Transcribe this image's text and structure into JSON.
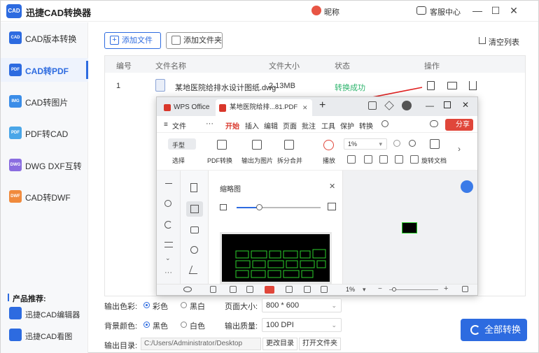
{
  "app": {
    "logo_text": "CAD",
    "title": "迅捷CAD转换器",
    "nickname": "昵称",
    "service": "客服中心",
    "brand_color": "#2d6be0"
  },
  "sidebar": {
    "items": [
      {
        "label": "CAD版本转换",
        "icon_text": "CAD",
        "color": "#2d6be0"
      },
      {
        "label": "CAD转PDF",
        "icon_text": "PDF",
        "color": "#2d6be0",
        "active": true
      },
      {
        "label": "CAD转图片",
        "icon_text": "IMG",
        "color": "#3b8de8"
      },
      {
        "label": "PDF转CAD",
        "icon_text": "PDF",
        "color": "#4aa6e8"
      },
      {
        "label": "DWG DXF互转",
        "icon_text": "DWG",
        "color": "#8a6de0"
      },
      {
        "label": "CAD转DWF",
        "icon_text": "DWF",
        "color": "#f08a3c"
      }
    ],
    "recommend_title": "产品推荐:",
    "recommend": [
      {
        "label": "迅捷CAD编辑器"
      },
      {
        "label": "迅捷CAD看图"
      }
    ]
  },
  "toolbar": {
    "add_file": "添加文件",
    "add_folder": "添加文件夹",
    "clear_list": "清空列表"
  },
  "table": {
    "headers": [
      "编号",
      "文件名称",
      "文件大小",
      "状态",
      "操作"
    ],
    "rows": [
      {
        "index": "1",
        "name": "某地医院给排水设计图纸.dwg",
        "size": "2.13MB",
        "status": "转换成功"
      }
    ]
  },
  "settings": {
    "color_label": "输出色彩:",
    "color_opt1": "彩色",
    "color_opt2": "黑白",
    "page_label": "页面大小:",
    "page_value": "800 * 600",
    "bg_label": "背景颜色:",
    "bg_opt1": "黑色",
    "bg_opt2": "白色",
    "quality_label": "输出质量:",
    "quality_value": "100 DPI",
    "dir_label": "输出目录:",
    "dir_value": "C:/Users/Administrator/Desktop",
    "change_dir": "更改目录",
    "open_folder": "打开文件夹",
    "convert_all": "全部转换"
  },
  "wps": {
    "tab_home": "WPS Office",
    "tab_doc": "某地医院给排...81.PDF",
    "menu": [
      "文件",
      "开始",
      "插入",
      "编辑",
      "页面",
      "批注",
      "工具",
      "保护",
      "转换"
    ],
    "share": "分享",
    "ribbon": {
      "hand": "手型",
      "select": "选择",
      "pdf_convert": "PDF转换",
      "to_image": "输出为图片",
      "split_merge": "拆分合并",
      "play": "播放",
      "zoom": "1%",
      "rotate": "旋转文档"
    },
    "thumb_title": "缩略图",
    "status_zoom": "1%"
  }
}
